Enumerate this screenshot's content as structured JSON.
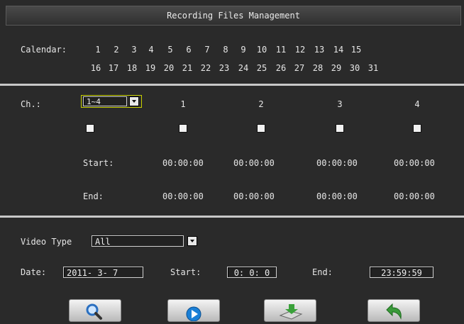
{
  "window": {
    "title": "Recording Files Management"
  },
  "calendar": {
    "label": "Calendar:",
    "row1": [
      "1",
      "2",
      "3",
      "4",
      "5",
      "6",
      "7",
      "8",
      "9",
      "10",
      "11",
      "12",
      "13",
      "14",
      "15"
    ],
    "row2": [
      "16",
      "17",
      "18",
      "19",
      "20",
      "21",
      "22",
      "23",
      "24",
      "25",
      "26",
      "27",
      "28",
      "29",
      "30",
      "31"
    ]
  },
  "channels": {
    "label": "Ch.:",
    "selector_value": "1~4",
    "columns": [
      "1",
      "2",
      "3",
      "4"
    ],
    "start_label": "Start:",
    "end_label": "End:",
    "start_times": [
      "00:00:00",
      "00:00:00",
      "00:00:00",
      "00:00:00"
    ],
    "end_times": [
      "00:00:00",
      "00:00:00",
      "00:00:00",
      "00:00:00"
    ]
  },
  "filter": {
    "video_type_label": "Video Type",
    "video_type_value": "All",
    "date_label": "Date:",
    "date_value": "2011- 3- 7",
    "start_label": "Start:",
    "start_value": "0: 0: 0",
    "end_label": "End:",
    "end_value": "23:59:59"
  },
  "buttons": {
    "search_icon": "magnifier-icon",
    "play_icon": "play-icon",
    "backup_icon": "backup-icon",
    "back_icon": "back-arrow-icon"
  },
  "colors": {
    "background": "#2a2a2a",
    "text": "#e6e6e6",
    "checkbox": "#f2f2f2",
    "play_blue": "#1a7fd6",
    "arrow_green": "#3a9a3a"
  }
}
